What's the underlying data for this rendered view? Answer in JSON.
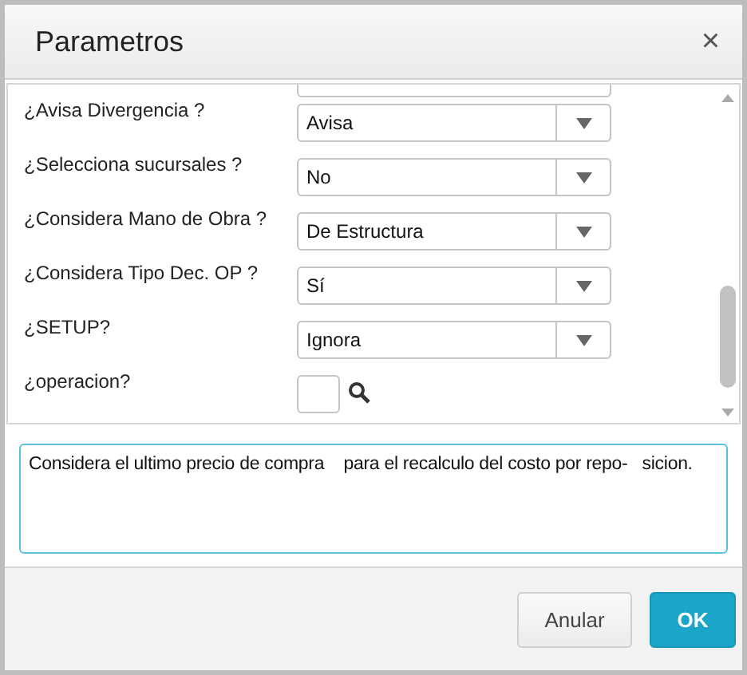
{
  "window": {
    "title": "Parametros",
    "close": "×"
  },
  "params": [
    {
      "kind": "select",
      "label": "¿Avisa Divergencia ?",
      "value": "Avisa"
    },
    {
      "kind": "select",
      "label": "¿Selecciona sucursales ?",
      "value": "No"
    },
    {
      "kind": "select",
      "label": "¿Considera Mano de Obra ?",
      "value": "De Estructura"
    },
    {
      "kind": "select",
      "label": "¿Considera Tipo Dec. OP ?",
      "value": "Sí"
    },
    {
      "kind": "select",
      "label": "¿SETUP?",
      "value": "Ignora"
    },
    {
      "kind": "lookup",
      "label": "¿operacion?"
    }
  ],
  "description": "Considera el ultimo precio de compra    para el recalculo del costo por repo-   sicion.",
  "buttons": [
    {
      "label": "Anular",
      "kind": "secondary"
    },
    {
      "label": "OK",
      "kind": "primary"
    }
  ]
}
